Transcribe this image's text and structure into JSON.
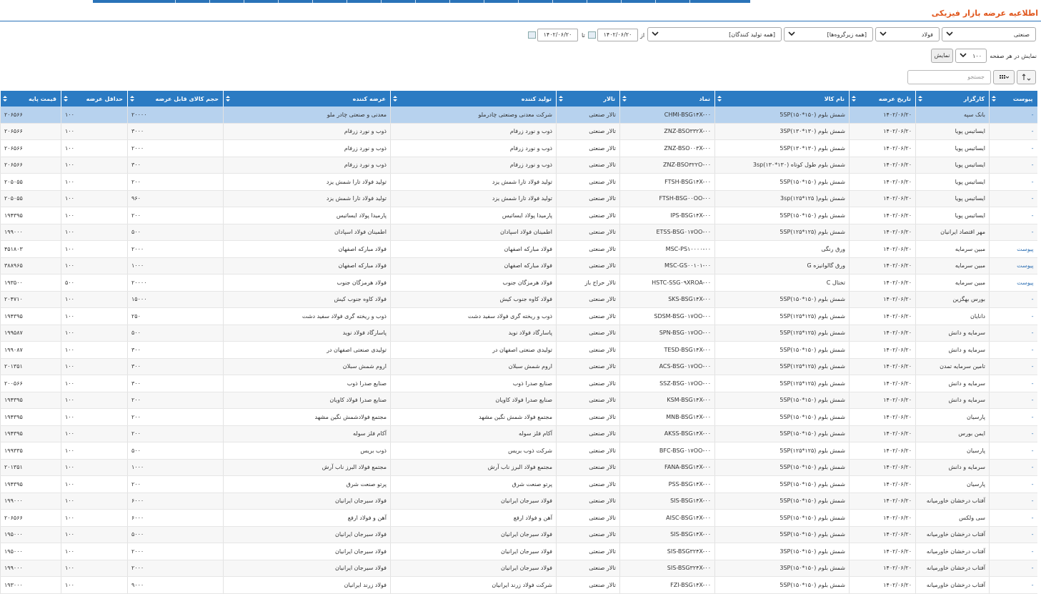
{
  "header": {
    "title": "اطلاعیه عرضه بازار فیزیکی"
  },
  "filters": {
    "market": "صنعتی",
    "group": "فولاد",
    "subgroup": "[همه زیرگروه‌ها]",
    "producer": "[همه تولید کنندگان]",
    "from_label": "از",
    "from_date": "۱۴۰۲/۰۶/۲۰",
    "to_label": "تا",
    "to_date": "۱۴۰۲/۰۶/۲۰",
    "page_size_label": "نمایش در هر صفحه",
    "page_size": "۱۰۰",
    "show_button": "نمایش",
    "search_placeholder": "جستجو"
  },
  "table": {
    "columns": [
      "پیوست",
      "کارگزار",
      "تاریخ عرضه",
      "نام کالا",
      "نماد",
      "تالار",
      "تولید کننده",
      "عرضه کننده",
      "حجم کالای قابل عرضه",
      "حداقل عرضه",
      "قیمت پایه"
    ],
    "rows": [
      [
        "-",
        "بانک سپه",
        "۱۴۰۲/۰۶/۲۰",
        "شمش بلوم (۱۵۰*۱۵۰)5SP",
        "CHMI-BSG۱۴X-۰۰",
        "تالار صنعتی",
        "شرکت معدنی وصنعتی چادرملو",
        "معدنی و صنعتی چادر ملو",
        "۲۰۰۰۰",
        "۱۰۰",
        "۲۰۶۵۶۶"
      ],
      [
        "-",
        "ایساتیس پویا",
        "۱۴۰۲/۰۶/۲۰",
        "شمش بلوم (۱۳۰*۱۳۰)3SP",
        "ZNZ-BSO۳۳۲X-۰۰",
        "تالار صنعتی",
        "ذوب و نورد زرفام",
        "ذوب و نورد زرفام",
        "۳۰۰۰",
        "۱۰۰",
        "۲۰۶۵۶۶"
      ],
      [
        "-",
        "ایساتیس پویا",
        "۱۴۰۲/۰۶/۲۰",
        "شمش بلوم (۱۳۰*۱۳۰)5SP",
        "ZNZ-BSO۰۰۳X-۰۰",
        "تالار صنعتی",
        "ذوب و نورد زرفام",
        "ذوب و نورد زرفام",
        "۲۰۰۰",
        "۱۰۰",
        "۲۰۶۵۶۶"
      ],
      [
        "-",
        "ایساتیس پویا",
        "۱۴۰۲/۰۶/۲۰",
        "شمش بلوم طول کوتاه (۱۳۰*۱۳۰)3sp",
        "ZNZ-BSO۳۲۲O-۰۰",
        "تالار صنعتی",
        "ذوب و نورد زرفام",
        "ذوب و نورد زرفام",
        "۳۰۰",
        "۱۰۰",
        "۲۰۶۵۶۶"
      ],
      [
        "-",
        "ایساتیس پویا",
        "۱۴۰۲/۰۶/۲۰",
        "شمش بلوم (۱۵۰*۱۵۰)5SP",
        "FTSH-BSG۱۴X-۰۰",
        "تالار صنعتی",
        "تولید فولاد تارا شمش یزد",
        "تولید فولاد تارا شمش یزد",
        "۲۰۰",
        "۱۰۰",
        "۲۰۵۰۵۵"
      ],
      [
        "-",
        "ایساتیس پویا",
        "۱۴۰۲/۰۶/۲۰",
        "شمش بلوم( ۱۲۵*۱۲۵)3sp",
        "FTSH-BSG۰۰OO-۰۰",
        "تالار صنعتی",
        "تولید فولاد تارا شمش یزد",
        "تولید فولاد تارا شمش یزد",
        "۹۶۰",
        "۱۰۰",
        "۲۰۵۰۵۵"
      ],
      [
        "-",
        "ایساتیس پویا",
        "۱۴۰۲/۰۶/۲۰",
        "شمش بلوم (۱۵۰*۱۵۰)5SP",
        "IPS-BSG۱۴X-۰۰",
        "تالار صنعتی",
        "پارمیدا پولاد ایساتیس",
        "پارمیدا پولاد ایساتیس",
        "۲۰۰",
        "۱۰۰",
        "۱۹۴۳۹۵"
      ],
      [
        "-",
        "مهر اقتصاد ایرانیان",
        "۱۴۰۲/۰۶/۲۰",
        "شمش بلوم (۱۲۵*۱۲۵)5SP",
        "ETSS-BSG۰۱۷OO-۰۰",
        "تالار صنعتی",
        "اطمینان فولاد اسپادان",
        "اطمینان فولاد اسپادان",
        "۵۰۰",
        "۱۰۰",
        "۱۹۹۰۰۰"
      ],
      [
        "پیوست",
        "مبین سرمایه",
        "۱۴۰۲/۰۶/۲۰",
        "ورق رنگی",
        "MSC-PS۱۰۰۰۰-۰۰",
        "تالار صنعتی",
        "فولاد مبارکه اصفهان",
        "فولاد مبارکه اصفهان",
        "۲۰۰۰",
        "۱۰۰",
        "۴۵۱۸۰۳"
      ],
      [
        "پیوست",
        "مبین سرمایه",
        "۱۴۰۲/۰۶/۲۰",
        "ورق گالوانیزه G",
        "MSC-GS۰۰۱۰۱-۰۰",
        "تالار صنعتی",
        "فولاد مبارکه اصفهان",
        "فولاد مبارکه اصفهان",
        "۱۰۰۰",
        "۱۰۰",
        "۳۸۸۹۶۵"
      ],
      [
        "پیوست",
        "مبین سرمایه",
        "۱۴۰۲/۰۶/۲۰",
        "تختال C",
        "HSTC-SSG۰۹XROA-۰۰",
        "تالار حراج باز",
        "فولاد هرمزگان جنوب",
        "فولاد هرمزگان جنوب",
        "۲۰۰۰۰",
        "۵۰۰",
        "۱۹۳۵۰۰"
      ],
      [
        "-",
        "بورس بهگزین",
        "۱۴۰۲/۰۶/۲۰",
        "شمش بلوم (۱۵۰*۱۵۰)5SP",
        "SKS-BSG۱۴X-۰۰",
        "تالار صنعتی",
        "فولاد کاوه جنوب کیش",
        "فولاد کاوه جنوب کیش",
        "۱۵۰۰۰",
        "۱۰۰",
        "۲۰۴۷۱۰"
      ],
      [
        "-",
        "دانایان",
        "۱۴۰۲/۰۶/۲۰",
        "شمش بلوم (۱۲۵*۱۲۵)5SP",
        "SDSM-BSG۰۱۷OO-۰۰",
        "تالار صنعتی",
        "ذوب و ریخته گری فولاد سفید دشت",
        "ذوب و ریخته گری فولاد سفید دشت",
        "۲۵۰",
        "۱۰۰",
        "۱۹۴۳۹۵"
      ],
      [
        "-",
        "سرمایه و دانش",
        "۱۴۰۲/۰۶/۲۰",
        "شمش بلوم (۱۲۵*۱۲۵)5SP",
        "SPN-BSG۰۱۷OO-۰۰",
        "تالار صنعتی",
        "پاسارگاد فولاد نوید",
        "پاسارگاد فولاد نوید",
        "۵۰۰",
        "۱۰۰",
        "۱۹۹۵۸۷"
      ],
      [
        "-",
        "سرمایه و دانش",
        "۱۴۰۲/۰۶/۲۰",
        "شمش بلوم (۱۵۰*۱۵۰)5SP",
        "TESD-BSG۱۴X-۰۰",
        "تالار صنعتی",
        "تولیدی صنعتی اصفهان در",
        "تولیدی صنعتی اصفهان در",
        "۳۰۰",
        "۱۰۰",
        "۱۹۹۰۸۷"
      ],
      [
        "-",
        "تامین سرمایه تمدن",
        "۱۴۰۲/۰۶/۲۰",
        "شمش بلوم (۱۲۵*۱۲۵)5SP",
        "ACS-BSG۰۱۷OO-۰۰",
        "تالار صنعتی",
        "اروم شمش سبلان",
        "اروم شمش سبلان",
        "۳۰۰",
        "۱۰۰",
        "۲۰۱۳۵۱"
      ],
      [
        "-",
        "سرمایه و دانش",
        "۱۴۰۲/۰۶/۲۰",
        "شمش بلوم (۱۲۵*۱۲۵)5SP",
        "SSZ-BSG۰۱۷OO-۰۰",
        "تالار صنعتی",
        "صنایع صدرا ذوب",
        "صنایع صدرا ذوب",
        "۳۰۰",
        "۱۰۰",
        "۲۰۰۵۶۶"
      ],
      [
        "-",
        "سرمایه و دانش",
        "۱۴۰۲/۰۶/۲۰",
        "شمش بلوم (۱۵۰*۱۵۰)5SP",
        "KSM-BSG۱۴X-۰۰",
        "تالار صنعتی",
        "صنایع صدرا فولاد کاویان",
        "صنایع صدرا فولاد کاویان",
        "۲۰۰",
        "۱۰۰",
        "۱۹۴۳۹۵"
      ],
      [
        "-",
        "پارسیان",
        "۱۴۰۲/۰۶/۲۰",
        "شمش بلوم (۱۵۰*۱۵۰)5SP",
        "MNB-BSG۱۴X-۰۰",
        "تالار صنعتی",
        "مجتمع فولاد شمش نگین مشهد",
        "مجتمع فولادشمش نگین مشهد",
        "۲۰۰",
        "۱۰۰",
        "۱۹۴۳۹۵"
      ],
      [
        "-",
        "ایمن بورس",
        "۱۴۰۲/۰۶/۲۰",
        "شمش بلوم (۱۵۰*۱۵۰)5SP",
        "AKSS-BSG۱۴X-۰۰",
        "تالار صنعتی",
        "آکام فلز سوله",
        "آکام فلز سوله",
        "۲۰۰",
        "۱۰۰",
        "۱۹۴۳۹۵"
      ],
      [
        "-",
        "پارسیان",
        "۱۴۰۲/۰۶/۲۰",
        "شمش بلوم (۱۲۵*۱۲۵)5SP",
        "BFC-BSG۰۱۷OO-۰۰",
        "تالار صنعتی",
        "شرکت ذوب بریس",
        "ذوب بریس",
        "۵۰۰",
        "۱۰۰",
        "۱۹۹۳۳۵"
      ],
      [
        "-",
        "سرمایه و دانش",
        "۱۴۰۲/۰۶/۲۰",
        "شمش بلوم (۱۵۰*۱۵۰)5SP",
        "FANA-BSG۱۴X-۰۰",
        "تالار صنعتی",
        "مجتمع فولاد البرز ناب آرش",
        "مجتمع فولاد البرز ناب آرش",
        "۱۰۰۰",
        "۱۰۰",
        "۲۰۱۳۵۱"
      ],
      [
        "-",
        "پارسیان",
        "۱۴۰۲/۰۶/۲۰",
        "شمش بلوم (۱۵۰*۱۵۰)5SP",
        "PSS-BSG۱۴X-۰۰",
        "تالار صنعتی",
        "پرتو صنعت شرق",
        "پرتو صنعت شرق",
        "۲۰۰",
        "۱۰۰",
        "۱۹۴۳۹۵"
      ],
      [
        "-",
        "آفتاب درخشان خاورمیانه",
        "۱۴۰۲/۰۶/۲۰",
        "شمش بلوم (۱۵۰*۱۵۰)5SP",
        "SIS-BSG۱۴X-۰۰",
        "تالار صنعتی",
        "فولاد سیرجان ایرانیان",
        "فولاد سیرجان ایرانیان",
        "۶۰۰۰",
        "۱۰۰",
        "۱۹۹۰۰۰"
      ],
      [
        "-",
        "سی ولکس",
        "۱۴۰۲/۰۶/۲۰",
        "شمش بلوم (۱۵۰*۱۵۰)5SP",
        "AISC-BSG۱۴X-۰۰",
        "تالار صنعتی",
        "آهن و فولاد ارفع",
        "آهن و فولاد ارفع",
        "۶۰۰۰",
        "۱۰۰",
        "۲۰۶۵۶۶"
      ],
      [
        "-",
        "آفتاب درخشان خاورمیانه",
        "۱۴۰۲/۰۶/۲۰",
        "شمش بلوم (۱۵۰*۱۵۰)5SP",
        "SIS-BSG۱۴X-۰۰",
        "تالار صنعتی",
        "فولاد سیرجان ایرانیان",
        "فولاد سیرجان ایرانیان",
        "۵۰۰۰",
        "۱۰۰",
        "۱۹۵۰۰۰"
      ],
      [
        "-",
        "آفتاب درخشان خاورمیانه",
        "۱۴۰۲/۰۶/۲۰",
        "شمش بلوم (۱۵۰*۱۵۰)3SP",
        "SIS-BSG۳۲۴X-۰۰",
        "تالار صنعتی",
        "فولاد سیرجان ایرانیان",
        "فولاد سیرجان ایرانیان",
        "۲۰۰۰",
        "۱۰۰",
        "۱۹۵۰۰۰"
      ],
      [
        "-",
        "آفتاب درخشان خاورمیانه",
        "۱۴۰۲/۰۶/۲۰",
        "شمش بلوم (۱۵۰*۱۵۰)3SP",
        "SIS-BSG۳۲۴X-۰۰",
        "تالار صنعتی",
        "فولاد سیرجان ایرانیان",
        "فولاد سیرجان ایرانیان",
        "۲۰۰۰",
        "۱۰۰",
        "۱۹۹۰۰۰"
      ],
      [
        "-",
        "آفتاب درخشان خاورمیانه",
        "۱۴۰۲/۰۶/۲۰",
        "شمش بلوم (۱۵۰*۱۵۰)5SP",
        "FZI-BSG۱۴X-۰۰",
        "تالار صنعتی",
        "شرکت فولاد زرند ایرانیان",
        "فولاد زرند ایرانیان",
        "۹۰۰۰",
        "۱۰۰",
        "۱۹۳۰۰۰"
      ]
    ]
  }
}
